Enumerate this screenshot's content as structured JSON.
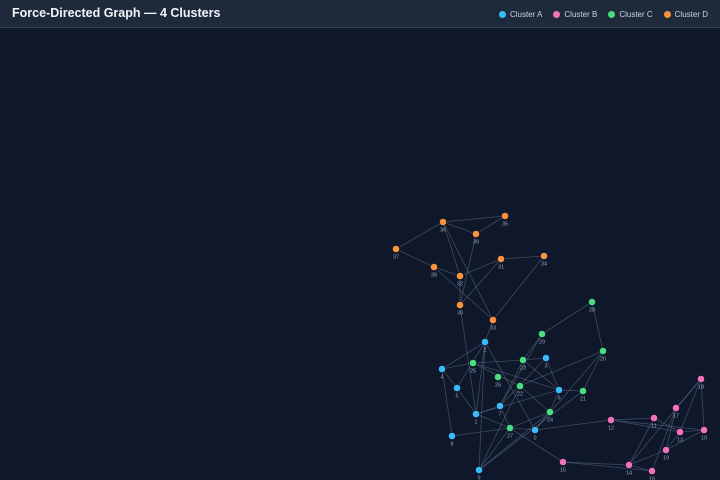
{
  "header": {
    "title": "Force-Directed Graph — 4 Clusters"
  },
  "colors": {
    "background": "#0f172a",
    "header": "#1e293b",
    "edge": "#64748b"
  },
  "legend": [
    {
      "label": "Cluster A",
      "color": "#38bdf8",
      "icon": "cluster-a-dot"
    },
    {
      "label": "Cluster B",
      "color": "#f472b6",
      "icon": "cluster-b-dot"
    },
    {
      "label": "Cluster C",
      "color": "#4ade80",
      "icon": "cluster-c-dot"
    },
    {
      "label": "Cluster D",
      "color": "#fb923c",
      "icon": "cluster-d-dot"
    }
  ],
  "chart_data": {
    "type": "network",
    "cluster_colors": {
      "A": "#38bdf8",
      "B": "#f472b6",
      "C": "#4ade80",
      "D": "#fb923c"
    },
    "nodes": [
      {
        "id": "0",
        "cluster": "A"
      },
      {
        "id": "1",
        "cluster": "A"
      },
      {
        "id": "2",
        "cluster": "A"
      },
      {
        "id": "3",
        "cluster": "A"
      },
      {
        "id": "4",
        "cluster": "A"
      },
      {
        "id": "5",
        "cluster": "A"
      },
      {
        "id": "6",
        "cluster": "A"
      },
      {
        "id": "7",
        "cluster": "A"
      },
      {
        "id": "8",
        "cluster": "A"
      },
      {
        "id": "9",
        "cluster": "A"
      },
      {
        "id": "10",
        "cluster": "B"
      },
      {
        "id": "11",
        "cluster": "B"
      },
      {
        "id": "12",
        "cluster": "B"
      },
      {
        "id": "13",
        "cluster": "B"
      },
      {
        "id": "14",
        "cluster": "B"
      },
      {
        "id": "15",
        "cluster": "B"
      },
      {
        "id": "16",
        "cluster": "B"
      },
      {
        "id": "17",
        "cluster": "B"
      },
      {
        "id": "18",
        "cluster": "B"
      },
      {
        "id": "19",
        "cluster": "B"
      },
      {
        "id": "20",
        "cluster": "C"
      },
      {
        "id": "21",
        "cluster": "C"
      },
      {
        "id": "22",
        "cluster": "C"
      },
      {
        "id": "23",
        "cluster": "C"
      },
      {
        "id": "24",
        "cluster": "C"
      },
      {
        "id": "25",
        "cluster": "C"
      },
      {
        "id": "26",
        "cluster": "C"
      },
      {
        "id": "27",
        "cluster": "C"
      },
      {
        "id": "28",
        "cluster": "C"
      },
      {
        "id": "29",
        "cluster": "C"
      },
      {
        "id": "30",
        "cluster": "D"
      },
      {
        "id": "31",
        "cluster": "D"
      },
      {
        "id": "32",
        "cluster": "D"
      },
      {
        "id": "33",
        "cluster": "D"
      },
      {
        "id": "34",
        "cluster": "D"
      },
      {
        "id": "35",
        "cluster": "D"
      },
      {
        "id": "36",
        "cluster": "D"
      },
      {
        "id": "37",
        "cluster": "D"
      },
      {
        "id": "38",
        "cluster": "D"
      },
      {
        "id": "39",
        "cluster": "D"
      }
    ],
    "edges": [
      [
        "36",
        "35"
      ],
      [
        "36",
        "39"
      ],
      [
        "36",
        "37"
      ],
      [
        "36",
        "32"
      ],
      [
        "36",
        "33"
      ],
      [
        "39",
        "35"
      ],
      [
        "39",
        "30"
      ],
      [
        "37",
        "38"
      ],
      [
        "38",
        "32"
      ],
      [
        "38",
        "33"
      ],
      [
        "32",
        "31"
      ],
      [
        "31",
        "34"
      ],
      [
        "34",
        "33"
      ],
      [
        "30",
        "32"
      ],
      [
        "30",
        "31"
      ],
      [
        "30",
        "1"
      ],
      [
        "33",
        "2"
      ],
      [
        "2",
        "4"
      ],
      [
        "2",
        "5"
      ],
      [
        "2",
        "1"
      ],
      [
        "2",
        "9"
      ],
      [
        "2",
        "0"
      ],
      [
        "4",
        "8"
      ],
      [
        "4",
        "5"
      ],
      [
        "4",
        "25"
      ],
      [
        "25",
        "23"
      ],
      [
        "25",
        "6"
      ],
      [
        "25",
        "22"
      ],
      [
        "22",
        "9"
      ],
      [
        "22",
        "24"
      ],
      [
        "22",
        "20"
      ],
      [
        "23",
        "29"
      ],
      [
        "23",
        "6"
      ],
      [
        "23",
        "7"
      ],
      [
        "23",
        "3"
      ],
      [
        "29",
        "28"
      ],
      [
        "29",
        "7"
      ],
      [
        "28",
        "20"
      ],
      [
        "20",
        "21"
      ],
      [
        "20",
        "0"
      ],
      [
        "9",
        "24"
      ],
      [
        "9",
        "21"
      ],
      [
        "21",
        "6"
      ],
      [
        "6",
        "3"
      ],
      [
        "6",
        "24"
      ],
      [
        "3",
        "7"
      ],
      [
        "7",
        "1"
      ],
      [
        "7",
        "27"
      ],
      [
        "1",
        "27"
      ],
      [
        "1",
        "6"
      ],
      [
        "24",
        "27"
      ],
      [
        "24",
        "0"
      ],
      [
        "27",
        "0"
      ],
      [
        "27",
        "9"
      ],
      [
        "8",
        "27"
      ],
      [
        "5",
        "1"
      ],
      [
        "0",
        "12"
      ],
      [
        "27",
        "15"
      ],
      [
        "12",
        "11"
      ],
      [
        "12",
        "13"
      ],
      [
        "12",
        "10"
      ],
      [
        "11",
        "13"
      ],
      [
        "11",
        "14"
      ],
      [
        "17",
        "18"
      ],
      [
        "17",
        "16"
      ],
      [
        "17",
        "19"
      ],
      [
        "18",
        "13"
      ],
      [
        "18",
        "10"
      ],
      [
        "18",
        "14"
      ],
      [
        "13",
        "10"
      ],
      [
        "13",
        "19"
      ],
      [
        "19",
        "14"
      ],
      [
        "14",
        "15"
      ],
      [
        "14",
        "16"
      ],
      [
        "16",
        "15"
      ],
      [
        "10",
        "19"
      ]
    ]
  }
}
